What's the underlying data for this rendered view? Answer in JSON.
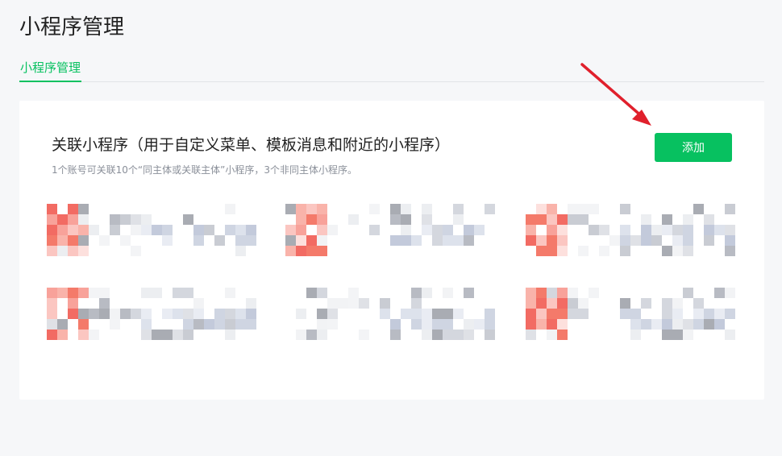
{
  "page": {
    "title": "小程序管理"
  },
  "tabs": [
    {
      "label": "小程序管理",
      "active": true
    }
  ],
  "section": {
    "title": "关联小程序（用于自定义菜单、模板消息和附近的小程序）",
    "description": "1个账号可关联10个“同主体或关联主体”小程序，3个非同主体小程序。",
    "add_button_label": "添加"
  },
  "mini_programs": {
    "count": 6,
    "obscured": true
  },
  "colors": {
    "accent": "#07c160",
    "annotation_arrow": "#e0202c"
  }
}
